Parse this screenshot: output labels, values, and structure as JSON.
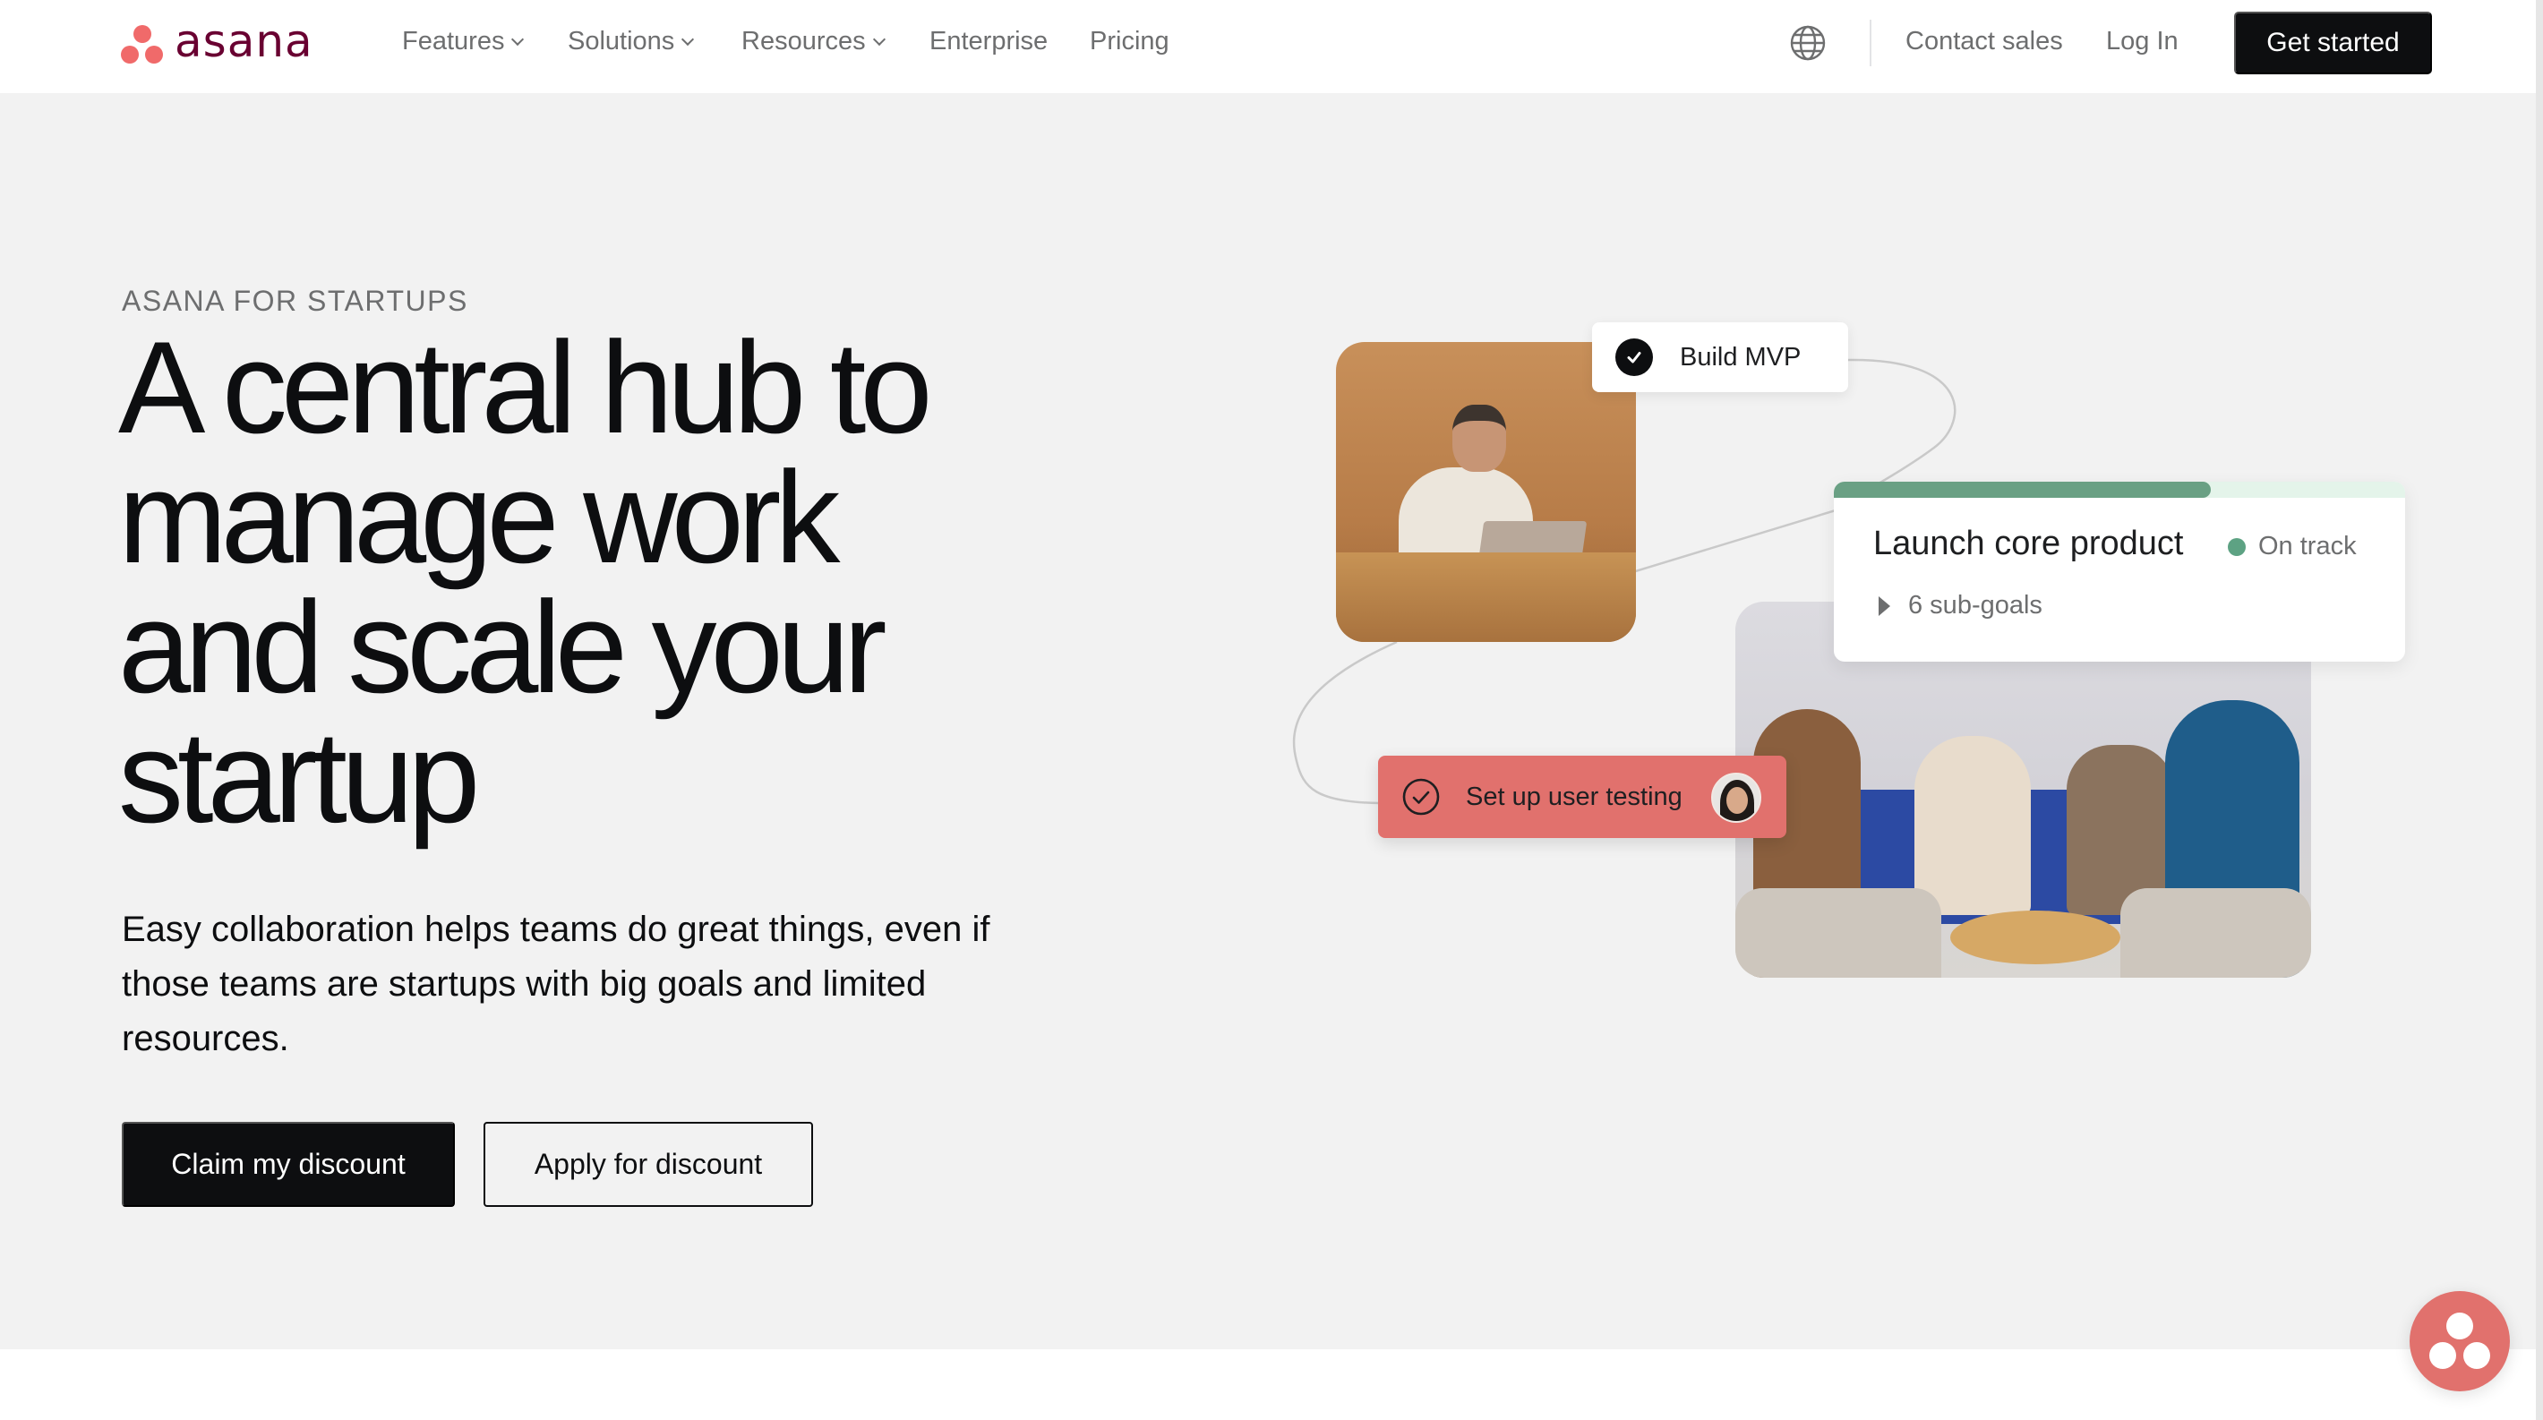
{
  "nav": {
    "logo_text": "asana",
    "items": [
      {
        "label": "Features",
        "has_dropdown": true
      },
      {
        "label": "Solutions",
        "has_dropdown": true
      },
      {
        "label": "Resources",
        "has_dropdown": true
      },
      {
        "label": "Enterprise",
        "has_dropdown": false
      },
      {
        "label": "Pricing",
        "has_dropdown": false
      }
    ],
    "language_icon": "globe-icon",
    "contact_sales": "Contact sales",
    "log_in": "Log In",
    "get_started": "Get started"
  },
  "hero": {
    "eyebrow": "ASANA FOR STARTUPS",
    "headline_lines": [
      "A central hub to",
      "manage work",
      "and scale your",
      "startup"
    ],
    "lede": "Easy collaboration helps teams do great things, even if those teams are startups with big goals and limited resources.",
    "primary_cta": "Claim my discount",
    "secondary_cta": "Apply for discount"
  },
  "illustration": {
    "task_done": {
      "label": "Build MVP",
      "icon": "check-circle-filled-icon"
    },
    "goal": {
      "title": "Launch core product",
      "status": "On track",
      "progress_percent": 66,
      "subgoals": "6 sub-goals"
    },
    "task_open": {
      "label": "Set up user testing",
      "icon": "check-circle-outline-icon"
    }
  },
  "colors": {
    "brand_coral": "#f06a6a",
    "brand_plum": "#690031",
    "chip_coral": "#e1716d",
    "status_green": "#5da283",
    "hero_bg": "#f2f2f2",
    "button_dark": "#0d0e10"
  },
  "fab": {
    "icon": "asana-logo-icon"
  }
}
